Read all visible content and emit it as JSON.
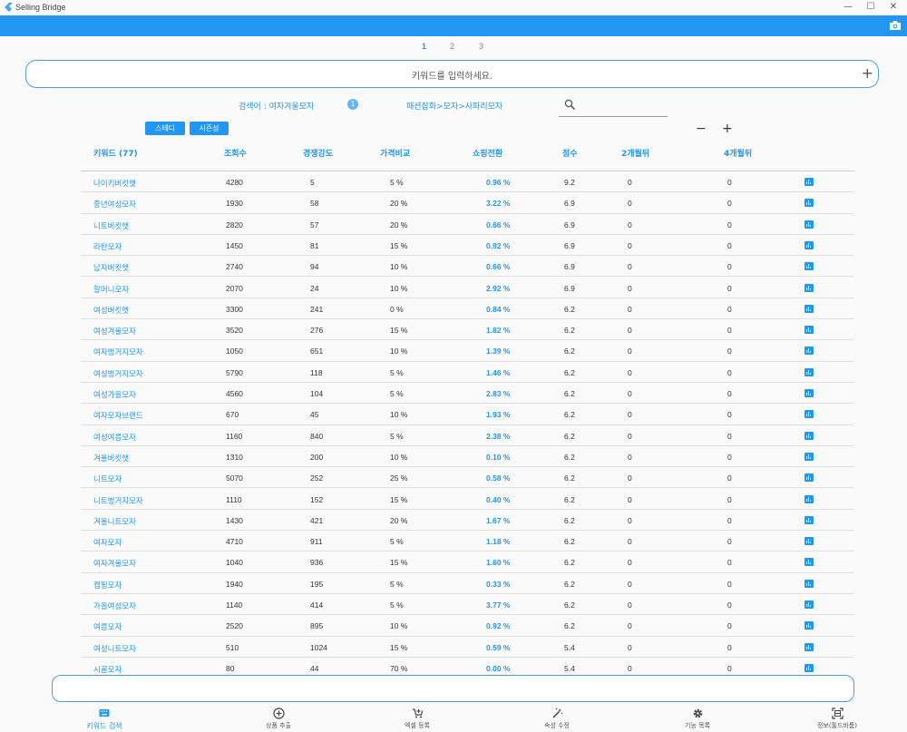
{
  "window": {
    "title": "Selling Bridge",
    "minimize": "—",
    "maximize": "☐",
    "close": "✕"
  },
  "pagination": [
    "1",
    "2",
    "3"
  ],
  "search": {
    "placeholder": "키워드를 입력하세요.",
    "add": "+"
  },
  "info": {
    "search_label": "검색어 : 여자겨울모자",
    "badge": "1",
    "category": "패션잡화>모자>사파리모자"
  },
  "buttons": {
    "steady": "스테디",
    "seasonal": "시즌성"
  },
  "zoom": {
    "minus": "−",
    "plus": "+"
  },
  "table": {
    "headers": [
      "키워드 (77)",
      "조회수",
      "경쟁강도",
      "가격비교",
      "쇼핑전환",
      "점수",
      "2개월뒤",
      "4개월뒤"
    ],
    "rows": [
      [
        "나이키버킷햇",
        "4280",
        "5",
        "5 %",
        "0.96 %",
        "9.2",
        "0",
        "0"
      ],
      [
        "중년여성모자",
        "1930",
        "58",
        "20 %",
        "3.22 %",
        "6.9",
        "0",
        "0"
      ],
      [
        "니트버킷햇",
        "2820",
        "57",
        "20 %",
        "0.66 %",
        "6.9",
        "0",
        "0"
      ],
      [
        "라탄모자",
        "1450",
        "81",
        "15 %",
        "0.92 %",
        "6.9",
        "0",
        "0"
      ],
      [
        "남자버킷햇",
        "2740",
        "94",
        "10 %",
        "0.66 %",
        "6.9",
        "0",
        "0"
      ],
      [
        "할머니모자",
        "2070",
        "24",
        "10 %",
        "2.92 %",
        "6.9",
        "0",
        "0"
      ],
      [
        "여성버킷햇",
        "3300",
        "241",
        "0 %",
        "0.84 %",
        "6.2",
        "0",
        "0"
      ],
      [
        "여성겨울모자",
        "3520",
        "276",
        "15 %",
        "1.82 %",
        "6.2",
        "0",
        "0"
      ],
      [
        "여자벙거지모자",
        "1050",
        "651",
        "10 %",
        "1.39 %",
        "6.2",
        "0",
        "0"
      ],
      [
        "여성벙거지모자",
        "5790",
        "118",
        "5 %",
        "1.46 %",
        "6.2",
        "0",
        "0"
      ],
      [
        "여성가을모자",
        "4560",
        "104",
        "5 %",
        "2.83 %",
        "6.2",
        "0",
        "0"
      ],
      [
        "여자모자브랜드",
        "670",
        "45",
        "10 %",
        "1.93 %",
        "6.2",
        "0",
        "0"
      ],
      [
        "여성여름모자",
        "1160",
        "840",
        "5 %",
        "2.38 %",
        "6.2",
        "0",
        "0"
      ],
      [
        "겨울버킷햇",
        "1310",
        "200",
        "10 %",
        "0.10 %",
        "6.2",
        "0",
        "0"
      ],
      [
        "니트모자",
        "5070",
        "252",
        "25 %",
        "0.58 %",
        "6.2",
        "0",
        "0"
      ],
      [
        "니트벙거지모자",
        "1110",
        "152",
        "15 %",
        "0.40 %",
        "6.2",
        "0",
        "0"
      ],
      [
        "겨울니트모자",
        "1430",
        "421",
        "20 %",
        "1.67 %",
        "6.2",
        "0",
        "0"
      ],
      [
        "여자모자",
        "4710",
        "911",
        "5 %",
        "1.18 %",
        "6.2",
        "0",
        "0"
      ],
      [
        "여자겨울모자",
        "1040",
        "936",
        "15 %",
        "1.60 %",
        "6.2",
        "0",
        "0"
      ],
      [
        "캠핑모자",
        "1940",
        "195",
        "5 %",
        "0.33 %",
        "6.2",
        "0",
        "0"
      ],
      [
        "가을여성모자",
        "1140",
        "414",
        "5 %",
        "3.77 %",
        "6.2",
        "0",
        "0"
      ],
      [
        "여름모자",
        "2520",
        "895",
        "10 %",
        "0.92 %",
        "6.2",
        "0",
        "0"
      ],
      [
        "여성니트모자",
        "510",
        "1024",
        "15 %",
        "0.59 %",
        "5.4",
        "0",
        "0"
      ],
      [
        "시골모자",
        "80",
        "44",
        "70 %",
        "0.00 %",
        "5.4",
        "0",
        "0"
      ]
    ]
  },
  "nav": [
    {
      "label": "키워드 검색",
      "icon": "keyboard-icon"
    },
    {
      "label": "상품 추출",
      "icon": "add-circle-icon"
    },
    {
      "label": "엑셀 등록",
      "icon": "cart-add-icon"
    },
    {
      "label": "속성 수정",
      "icon": "magic-wand-icon"
    },
    {
      "label": "기능 목록",
      "icon": "gear-icon"
    },
    {
      "label": "정보(툴드바툼)",
      "icon": "scan-icon"
    }
  ],
  "colors": {
    "accent": "#2196f3",
    "text": "#333333"
  }
}
